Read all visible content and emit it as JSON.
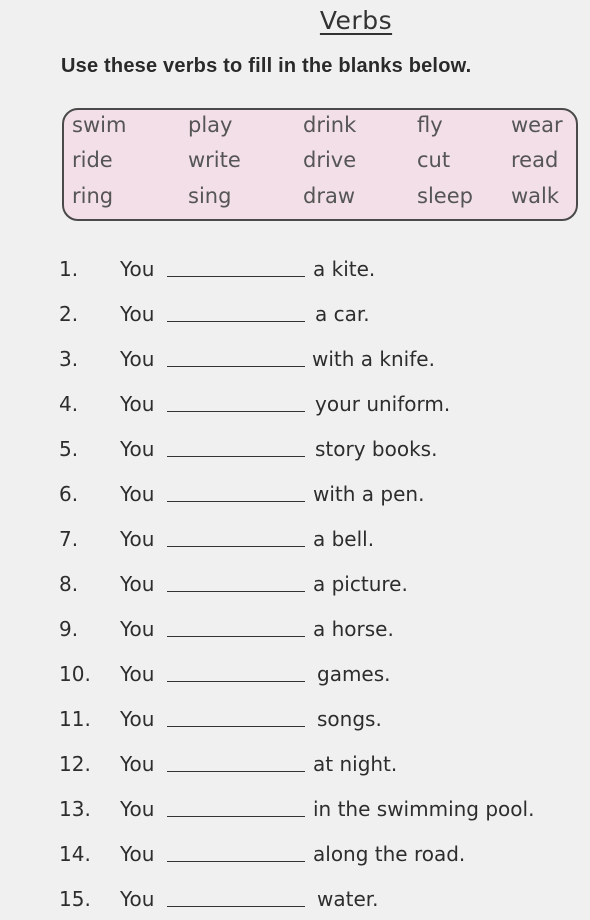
{
  "title": "Verbs",
  "instruction": "Use these verbs to fill in the blanks below.",
  "verbs": [
    [
      "swim",
      "play",
      "drink",
      "fly",
      "wear"
    ],
    [
      "ride",
      "write",
      "drive",
      "cut",
      "read"
    ],
    [
      "ring",
      "sing",
      "draw",
      "sleep",
      "walk"
    ]
  ],
  "subject": "You",
  "sentences": [
    {
      "num": "1.",
      "rest": "a kite."
    },
    {
      "num": "2.",
      "rest": "a car."
    },
    {
      "num": "3.",
      "rest": "with a knife."
    },
    {
      "num": "4.",
      "rest": "your uniform."
    },
    {
      "num": "5.",
      "rest": "story books."
    },
    {
      "num": "6.",
      "rest": "with a pen."
    },
    {
      "num": "7.",
      "rest": "a bell."
    },
    {
      "num": "8.",
      "rest": "a picture."
    },
    {
      "num": "9.",
      "rest": "a horse."
    },
    {
      "num": "10.",
      "rest": "games."
    },
    {
      "num": "11.",
      "rest": "songs."
    },
    {
      "num": "12.",
      "rest": "at night."
    },
    {
      "num": "13.",
      "rest": "in the swimming pool."
    },
    {
      "num": "14.",
      "rest": "along the road."
    },
    {
      "num": "15.",
      "rest": "water."
    }
  ],
  "colors": {
    "page_background": "#f1f0f0",
    "word_box_fill": "#f2dfe7",
    "word_box_border": "#4a4a4a"
  }
}
